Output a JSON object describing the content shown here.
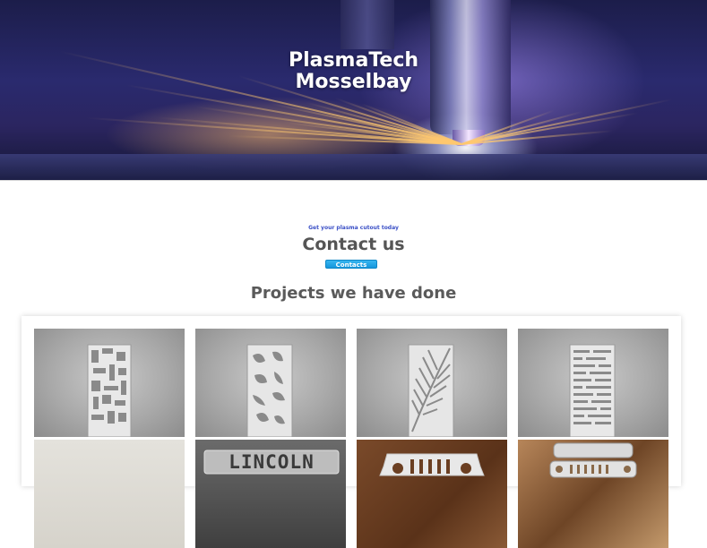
{
  "hero": {
    "title_line1": "PlasmaTech",
    "title_line2": "Mosselbay"
  },
  "contact": {
    "tagline": "Get your plasma cutout today",
    "heading": "Contact us",
    "button_label": "Contacts"
  },
  "projects": {
    "heading": "Projects we have done",
    "items": [
      {
        "name": "geometric-panel"
      },
      {
        "name": "leaf-panel"
      },
      {
        "name": "palm-frond-panel"
      },
      {
        "name": "brick-pattern-panel"
      },
      {
        "name": "wall-piece"
      },
      {
        "name": "lincoln-sign"
      },
      {
        "name": "jeep-grille"
      },
      {
        "name": "jeep-bottle-openers"
      }
    ],
    "sign_text": "LINCOLN"
  },
  "colors": {
    "accent_blue": "#1596dc",
    "tagline_blue": "#3a4fc6",
    "heading_gray": "#555555"
  }
}
